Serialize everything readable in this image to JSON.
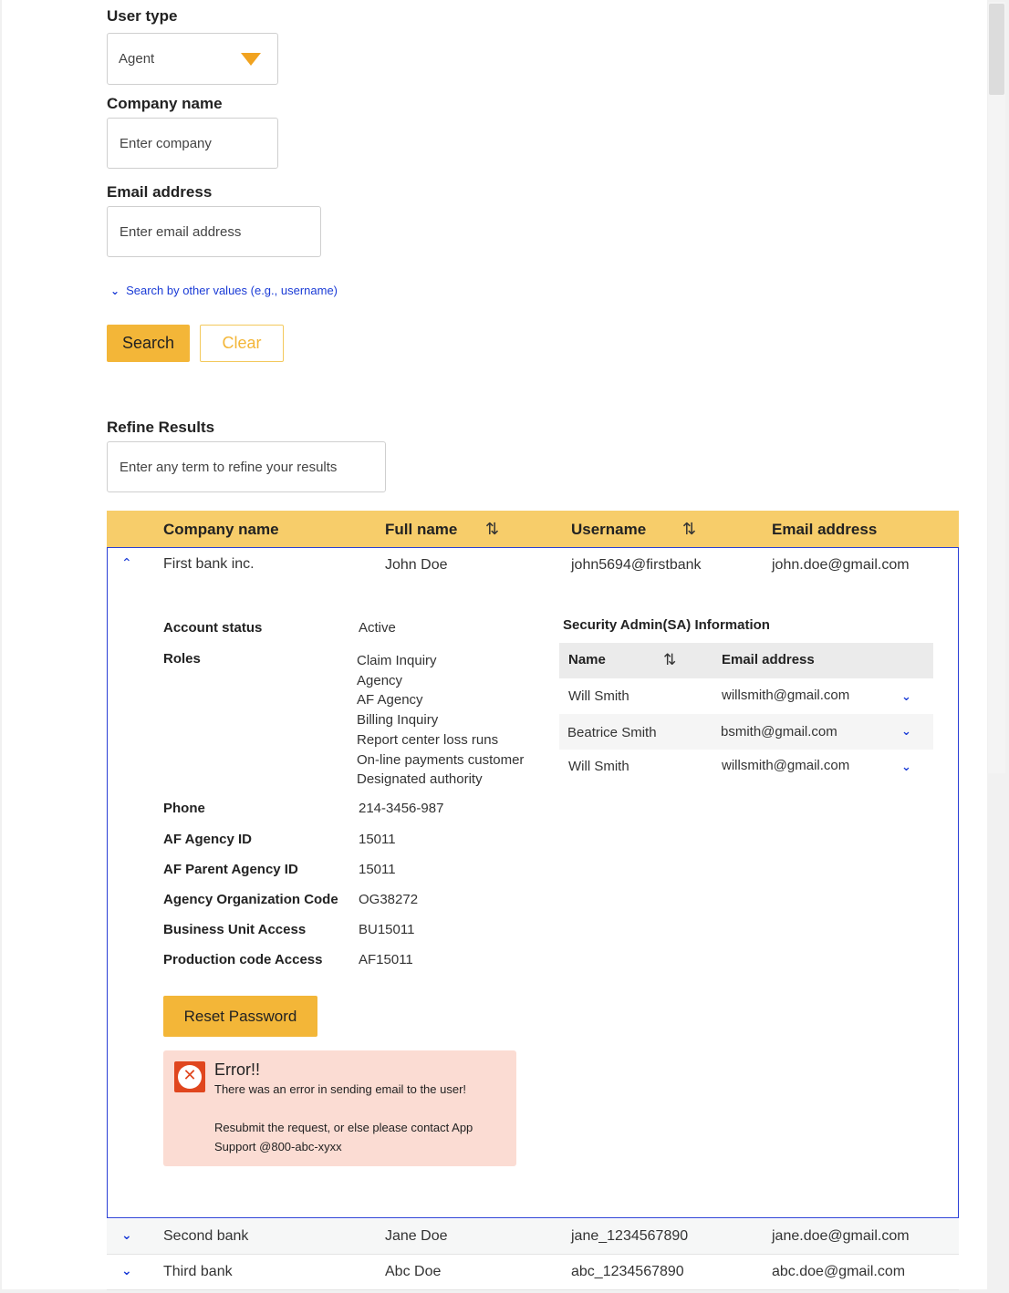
{
  "form": {
    "user_type_label": "User type",
    "user_type_value": "Agent",
    "company_label": "Company name",
    "company_placeholder": "Enter company",
    "email_label": "Email address",
    "email_placeholder": "Enter email address",
    "other_values_link": "Search by other values (e.g., username)",
    "search_button": "Search",
    "clear_button": "Clear"
  },
  "refine": {
    "label": "Refine Results",
    "placeholder": "Enter any term to refine your results"
  },
  "table": {
    "headers": {
      "company": "Company name",
      "full_name": "Full name",
      "username": "Username",
      "email": "Email address"
    },
    "rows": [
      {
        "company": "First bank inc.",
        "full_name": "John Doe",
        "username": "john5694@firstbank",
        "email": "john.doe@gmail.com"
      },
      {
        "company": "Second bank",
        "full_name": "Jane Doe",
        "username": "jane_1234567890",
        "email": "jane.doe@gmail.com"
      },
      {
        "company": "Third bank",
        "full_name": "Abc Doe",
        "username": "abc_1234567890",
        "email": "abc.doe@gmail.com"
      }
    ]
  },
  "details": {
    "account_status_label": "Account status",
    "account_status_value": "Active",
    "roles_label": "Roles",
    "roles": [
      "Claim Inquiry",
      "Agency",
      "AF Agency",
      "Billing Inquiry",
      "Report center loss runs",
      "On-line payments customer",
      "Designated authority"
    ],
    "phone_label": "Phone",
    "phone_value": "214-3456-987",
    "af_agency_id_label": "AF Agency ID",
    "af_agency_id_value": "15011",
    "af_parent_label": "AF Parent Agency ID",
    "af_parent_value": "15011",
    "org_code_label": "Agency Organization Code",
    "org_code_value": "OG38272",
    "bu_access_label": "Business Unit Access",
    "bu_access_value": "BU15011",
    "prod_code_label": "Production code Access",
    "prod_code_value": "AF15011",
    "reset_button": "Reset Password"
  },
  "sa": {
    "title": "Security Admin(SA) Information",
    "name_header": "Name",
    "email_header": "Email address",
    "rows": [
      {
        "name": "Will Smith",
        "email": "willsmith@gmail.com"
      },
      {
        "name": "Beatrice Smith",
        "email": "bsmith@gmail.com"
      },
      {
        "name": "Will Smith",
        "email": "willsmith@gmail.com"
      }
    ]
  },
  "error": {
    "title": "Error!!",
    "line1": "There was an error in sending email to the user!",
    "line2": "Resubmit the request, or else please contact App",
    "line3": "Support @800-abc-xyxx"
  },
  "icons": {
    "dropdown_arrow_color": "#f1a320",
    "accent": "#f3b638",
    "link_color": "#1a3bd6",
    "error_color": "#e0461e"
  }
}
